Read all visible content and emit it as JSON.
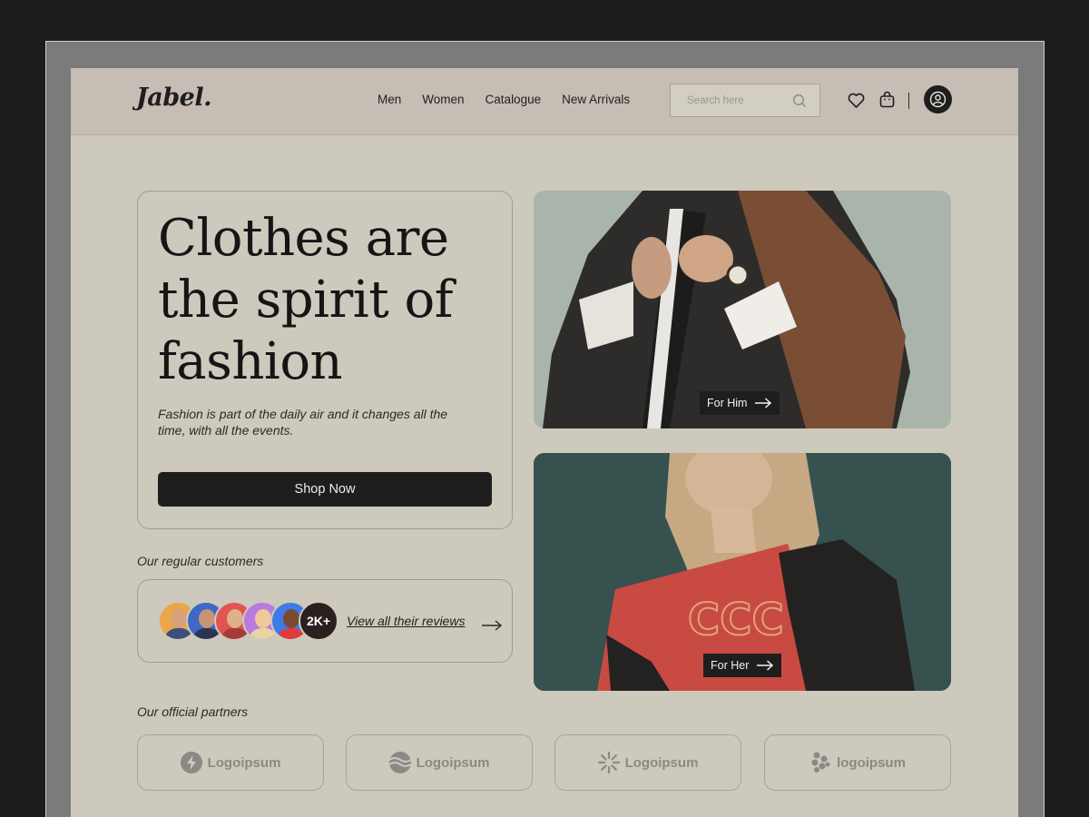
{
  "brand": {
    "logo": "Jabel."
  },
  "nav": {
    "items": [
      {
        "label": "Men"
      },
      {
        "label": "Women"
      },
      {
        "label": "Catalogue"
      },
      {
        "label": "New Arrivals"
      }
    ]
  },
  "search": {
    "placeholder": "Search here"
  },
  "hero": {
    "title": "Clothes are the spirit of fashion",
    "subtitle": "Fashion is part of the daily air and it changes all the time, with all the events.",
    "cta": "Shop Now"
  },
  "customers": {
    "label": "Our regular customers",
    "count_badge": "2K+",
    "link": "View all their reviews"
  },
  "categories": [
    {
      "label": "For Him"
    },
    {
      "label": "For Her"
    }
  ],
  "partners": {
    "label": "Our official partners",
    "items": [
      {
        "name": "Logoipsum",
        "icon": "bolt-icon"
      },
      {
        "name": "Logoipsum",
        "icon": "wave-globe-icon"
      },
      {
        "name": "Logoipsum",
        "icon": "sunburst-icon"
      },
      {
        "name": "logoipsum",
        "icon": "dots-cluster-icon"
      }
    ]
  },
  "colors": {
    "background": "#cdc9bd",
    "header": "#c6bdb4",
    "dark": "#1e1e1e",
    "frame": "#7b7b7b"
  },
  "icons": {
    "search": "search-icon",
    "wishlist": "heart-icon",
    "cart": "shopping-bag-icon",
    "account": "user-icon",
    "arrow": "arrow-right-icon"
  }
}
